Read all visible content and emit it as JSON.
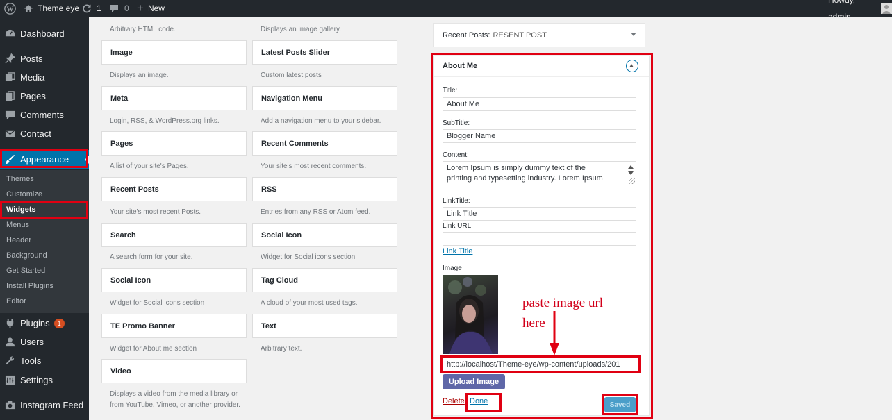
{
  "adminbar": {
    "site_name": "Theme eye",
    "updates_count": "1",
    "comments_count": "0",
    "new_label": "New",
    "greeting": "Howdy, admin"
  },
  "sidebar": {
    "dashboard": "Dashboard",
    "posts": "Posts",
    "media": "Media",
    "pages": "Pages",
    "comments": "Comments",
    "contact": "Contact",
    "appearance": "Appearance",
    "submenu": [
      "Themes",
      "Customize",
      "Widgets",
      "Menus",
      "Header",
      "Background",
      "Get Started",
      "Install Plugins",
      "Editor"
    ],
    "plugins": "Plugins",
    "plugins_badge": "1",
    "users": "Users",
    "tools": "Tools",
    "settings": "Settings",
    "instagram": "Instagram Feed"
  },
  "widgets": {
    "col1": [
      {
        "desc_top": "Arbitrary HTML code."
      },
      {
        "title": "Image",
        "desc": "Displays an image."
      },
      {
        "title": "Meta",
        "desc": "Login, RSS, & WordPress.org links."
      },
      {
        "title": "Pages",
        "desc": "A list of your site's Pages."
      },
      {
        "title": "Recent Posts",
        "desc": "Your site's most recent Posts."
      },
      {
        "title": "Search",
        "desc": "A search form for your site."
      },
      {
        "title": "Social Icon",
        "desc": "Widget for Social icons section"
      },
      {
        "title": "TE Promo Banner",
        "desc": "Widget for About me section"
      },
      {
        "title": "Video",
        "desc": "Displays a video from the media library or from YouTube, Vimeo, or another provider."
      }
    ],
    "col2": [
      {
        "desc_top": "Displays an image gallery."
      },
      {
        "title": "Latest Posts Slider",
        "desc": "Custom latest posts"
      },
      {
        "title": "Navigation Menu",
        "desc": "Add a navigation menu to your sidebar."
      },
      {
        "title": "Recent Comments",
        "desc": "Your site's most recent comments."
      },
      {
        "title": "RSS",
        "desc": "Entries from any RSS or Atom feed."
      },
      {
        "title": "Social Icon",
        "desc": "Widget for Social icons section"
      },
      {
        "title": "Tag Cloud",
        "desc": "A cloud of your most used tags."
      },
      {
        "title": "Text",
        "desc": "Arbitrary text."
      }
    ]
  },
  "sidebar_widgets": {
    "recent_posts_label": "Recent Posts",
    "recent_posts_title": "RESENT POST",
    "about_me": {
      "header": "About Me",
      "title_label": "Title:",
      "title_value": "About Me",
      "subtitle_label": "SubTitle:",
      "subtitle_value": "Blogger Name",
      "content_label": "Content:",
      "content_line1": "Lorem Ipsum is simply dummy text of the",
      "content_line2": "printing and typesetting industry. Lorem Ipsum",
      "linktitle_label": "LinkTitle:",
      "linktitle_value": "Link Title",
      "linkurl_label": "Link URL:",
      "linkurl_value": "",
      "link_preview": "Link Title",
      "image_label": "Image",
      "image_url": "http://localhost/Theme-eye/wp-content/uploads/201",
      "upload_button": "Upload Image",
      "delete_link": "Delete",
      "done_link": "Done",
      "saved_button": "Saved"
    }
  },
  "annotation": {
    "line1": "paste image url",
    "line2": "here"
  },
  "colors": {
    "admin_dark": "#23282d",
    "accent": "#0073aa",
    "highlight_red": "#e00012",
    "annotation_red": "#d2001a",
    "upload_button": "#5f67a8",
    "saved_button": "#4a9ec9"
  }
}
